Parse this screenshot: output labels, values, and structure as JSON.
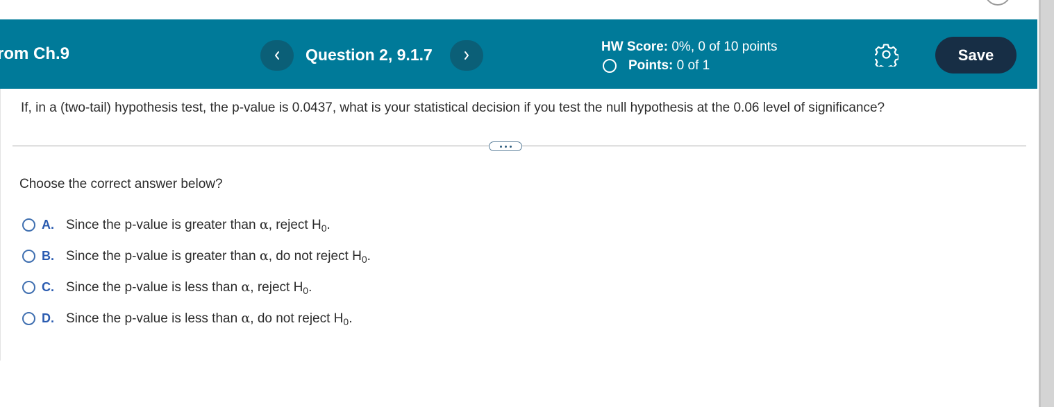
{
  "header": {
    "assignment_title": "rom Ch.9",
    "question_label": "Question 2, 9.1.7",
    "hw_score_label": "HW Score:",
    "hw_score_value": " 0%, 0 of 10 points",
    "points_label": "Points:",
    "points_value": " 0 of 1",
    "save_label": "Save",
    "prev_icon": "chevron-left-icon",
    "next_icon": "chevron-right-icon",
    "settings_icon": "gear-icon",
    "bg_color": "#007a99",
    "save_bg_color": "#172e45"
  },
  "question": {
    "text": "If, in a (two-tail) hypothesis test, the p-value is 0.0437, what is your statistical decision if you test the null hypothesis at the 0.06 level of significance?",
    "instruction": "Choose the correct answer below?",
    "options": [
      {
        "letter": "A.",
        "prefix": "Since the p-value is greater than ",
        "alpha": "α",
        "suffix": ", reject H",
        "sub": "0",
        "end": "."
      },
      {
        "letter": "B.",
        "prefix": "Since the p-value is greater than ",
        "alpha": "α",
        "suffix": ", do not reject H",
        "sub": "0",
        "end": "."
      },
      {
        "letter": "C.",
        "prefix": "Since the p-value is less than ",
        "alpha": "α",
        "suffix": ", reject H",
        "sub": "0",
        "end": "."
      },
      {
        "letter": "D.",
        "prefix": "Since the p-value is less than ",
        "alpha": "α",
        "suffix": ", do not reject H",
        "sub": "0",
        "end": "."
      }
    ]
  }
}
